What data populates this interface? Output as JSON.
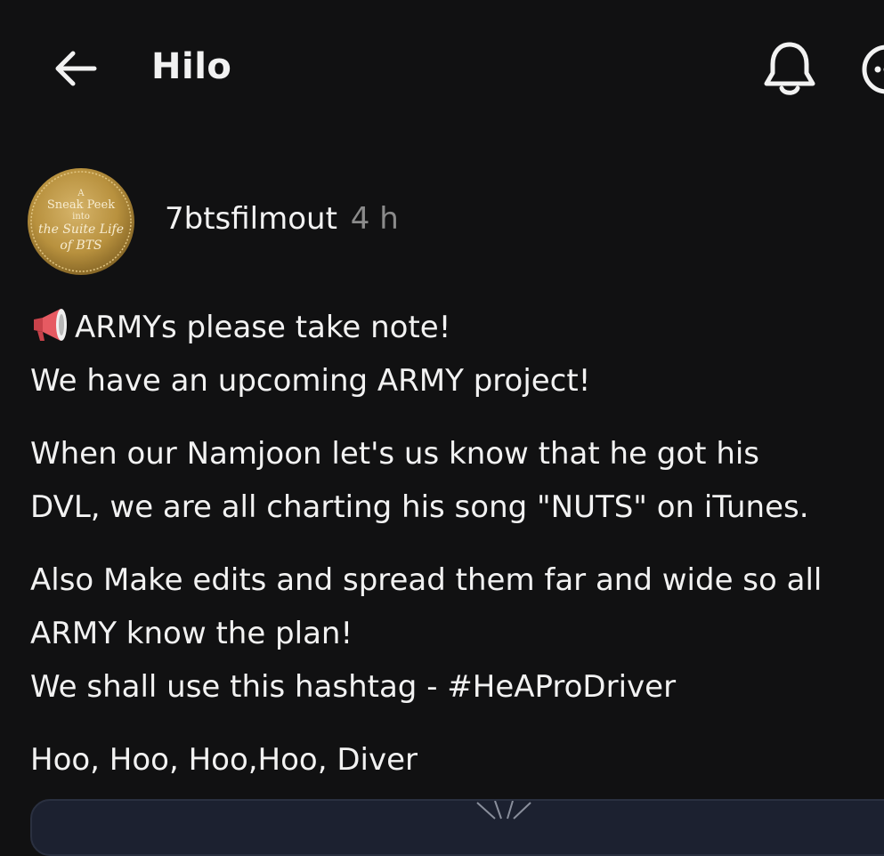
{
  "header": {
    "title": "Hilo",
    "back_icon": "arrow-left-icon",
    "bell_icon": "bell-icon",
    "more_icon": "more-circle-icon"
  },
  "post": {
    "author": "7btsfilmout",
    "time": "4 h",
    "avatar_lines": [
      "A",
      "Sneak Peek",
      "into",
      "the Suite Life",
      "of BTS"
    ],
    "megaphone_icon": "megaphone-icon",
    "paragraphs": [
      [
        "ARMYs please take note!",
        "We have an upcoming ARMY project!"
      ],
      [
        "When our Namjoon let's us know that he got his",
        "DVL, we are all charting his song \"NUTS\" on iTunes."
      ],
      [
        "Also Make edits and spread them far and wide so all",
        "ARMY know the plan!",
        "We shall use this hashtag - #HeAProDriver"
      ],
      [
        "Hoo, Hoo, Hoo,Hoo, Diver"
      ]
    ]
  },
  "colors": {
    "background": "#111112",
    "text": "#f2f2f2",
    "muted": "#8b8b8b",
    "avatar_gold": "#b8913e"
  }
}
